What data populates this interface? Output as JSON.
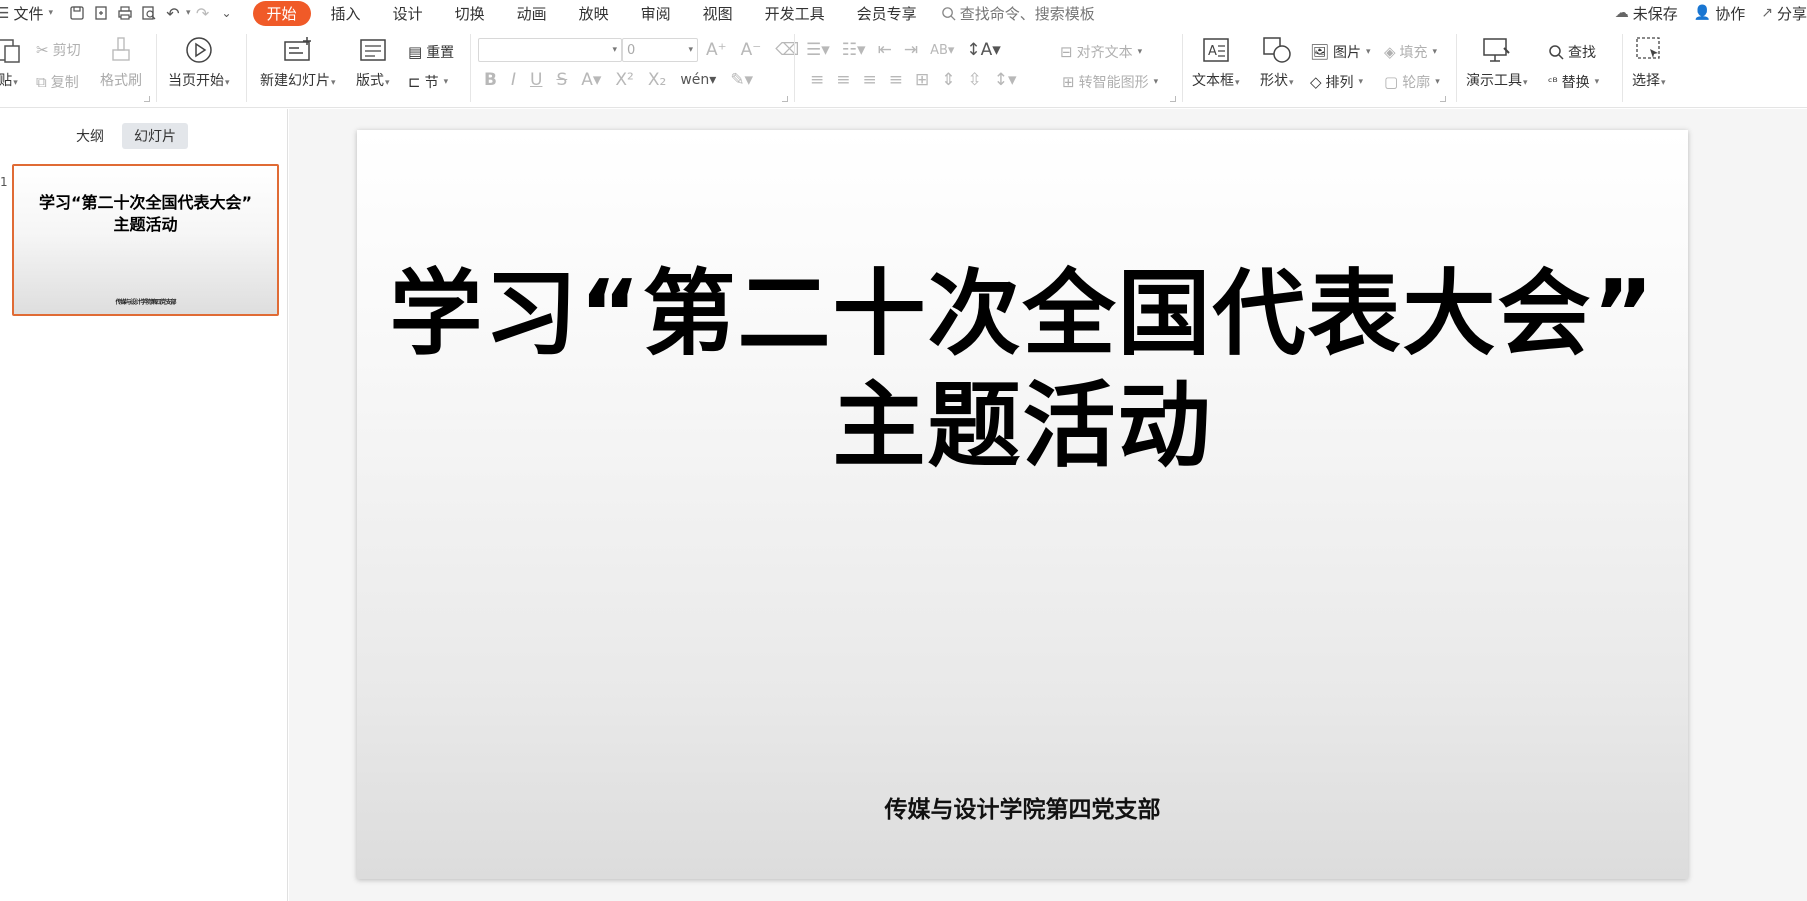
{
  "menu": {
    "file": "文件",
    "tabs": [
      "开始",
      "插入",
      "设计",
      "切换",
      "动画",
      "放映",
      "审阅",
      "视图",
      "开发工具",
      "会员专享"
    ],
    "search_placeholder": "查找命令、搜索模板",
    "unsaved": "未保存",
    "collab": "协作",
    "share": "分享"
  },
  "ribbon": {
    "paste": "贴",
    "cut": "剪切",
    "copy": "复制",
    "format_painter": "格式刷",
    "play_from_current": "当页开始",
    "new_slide": "新建幻灯片",
    "layout": "版式",
    "reset": "重置",
    "section": "节",
    "font_name": "",
    "font_size": "0",
    "align_text": "对齐文本",
    "smartart": "转智能图形",
    "textbox": "文本框",
    "shape": "形状",
    "picture": "图片",
    "fill": "填充",
    "arrange": "排列",
    "outline": "轮廓",
    "present_tools": "演示工具",
    "find": "查找",
    "replace": "替换",
    "select": "选择"
  },
  "panel": {
    "outline_tab": "大纲",
    "slides_tab": "幻灯片",
    "slide_number": "1"
  },
  "slide": {
    "title_line1": "学习“第二十次全国代表大会”",
    "title_line2": "主题活动",
    "subtitle": "传媒与设计学院第四党支部"
  },
  "colors": {
    "accent": "#f05a28",
    "thumb_border": "#e06b35"
  }
}
